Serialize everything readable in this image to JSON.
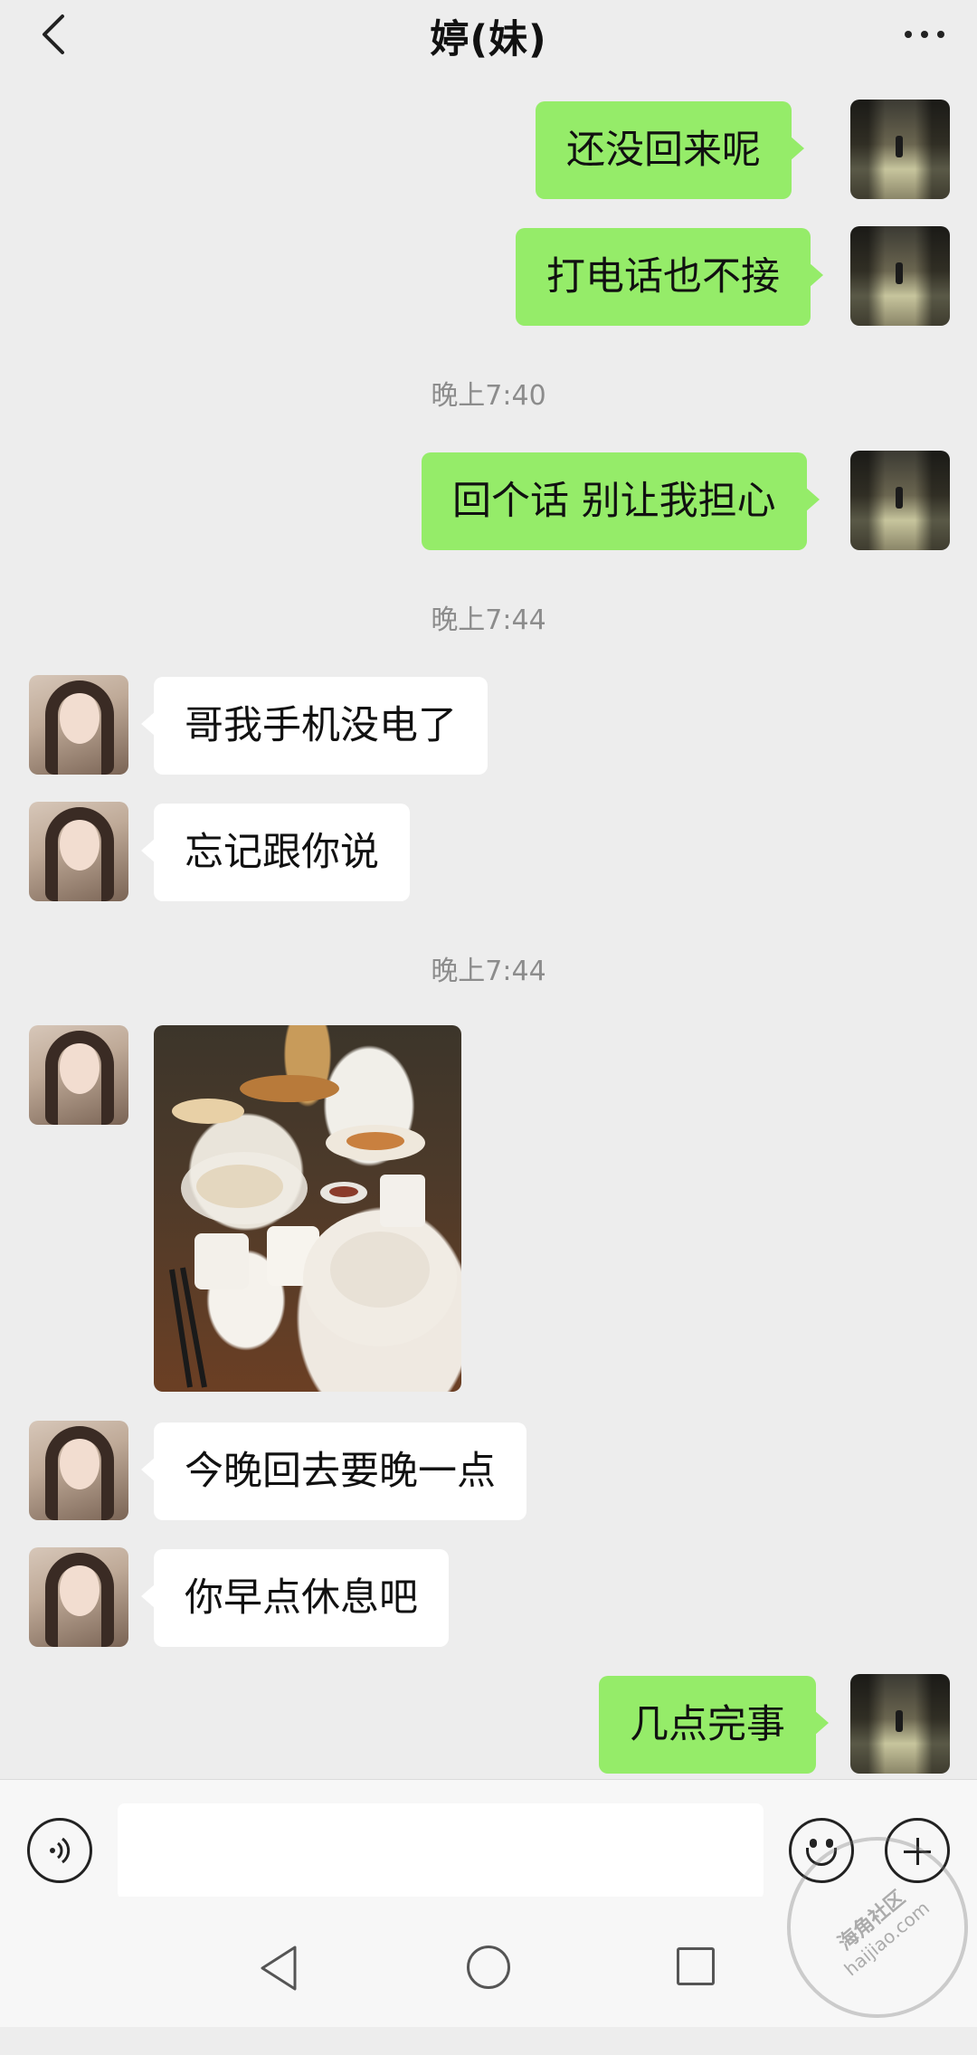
{
  "header": {
    "title": "婷(妹)",
    "back_icon": "chevron-left-icon",
    "more_icon": "more-dots-icon"
  },
  "messages": [
    {
      "side": "me",
      "type": "text",
      "text": "还没回来呢"
    },
    {
      "side": "me",
      "type": "text",
      "text": "打电话也不接"
    },
    {
      "type": "time",
      "text": "晚上7:40"
    },
    {
      "side": "me",
      "type": "text",
      "text": "回个话 别让我担心"
    },
    {
      "type": "time",
      "text": "晚上7:44"
    },
    {
      "side": "her",
      "type": "text",
      "text": "哥我手机没电了"
    },
    {
      "side": "her",
      "type": "text",
      "text": "忘记跟你说"
    },
    {
      "type": "time",
      "text": "晚上7:44"
    },
    {
      "side": "her",
      "type": "image",
      "description": "dinner-table-photo"
    },
    {
      "side": "her",
      "type": "text",
      "text": "今晚回去要晚一点"
    },
    {
      "side": "her",
      "type": "text",
      "text": "你早点休息吧"
    },
    {
      "side": "me",
      "type": "text",
      "text": "几点完事"
    }
  ],
  "input_bar": {
    "voice_icon": "voice-icon",
    "text_value": "",
    "emoji_icon": "emoji-icon",
    "plus_icon": "plus-icon"
  },
  "navbar": {
    "back_icon": "triangle-back-icon",
    "home_icon": "circle-home-icon",
    "recent_icon": "square-recent-icon"
  },
  "watermark": {
    "title": "海角社区",
    "url": "haijiao.com"
  },
  "colors": {
    "background": "#ededed",
    "sent_bubble": "#95ec69",
    "received_bubble": "#ffffff",
    "timestamp": "#8c8c8c"
  }
}
